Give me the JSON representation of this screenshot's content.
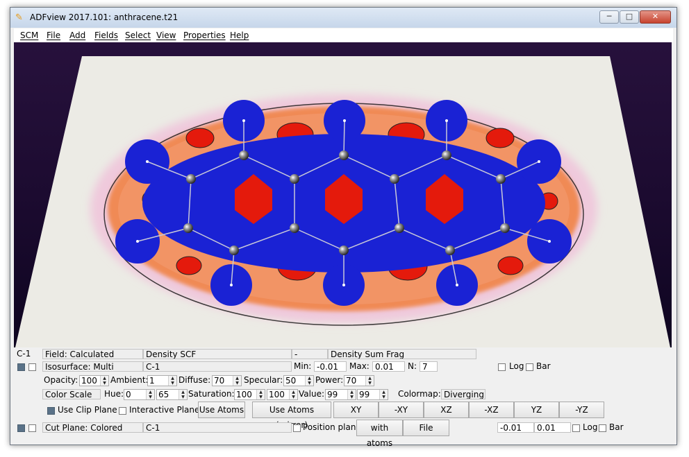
{
  "window": {
    "title": "ADFview 2017.101: anthracene.t21",
    "minimize_glyph": "─",
    "maximize_glyph": "□",
    "close_glyph": "✕"
  },
  "menu": [
    "SCM",
    "File",
    "Add",
    "Fields",
    "Select",
    "View",
    "Properties",
    "Help"
  ],
  "field_row": {
    "id": "C-1",
    "field": "Field: Calculated",
    "name": "Density SCF",
    "op": "-",
    "name2": "Density Sum Frag"
  },
  "iso_row": {
    "iso": "Isosurface: Multi",
    "frag": "C-1",
    "min_label": "Min:",
    "min": "-0.01",
    "max_label": "Max:",
    "max": "0.01",
    "n_label": "N:",
    "n": "7",
    "log": "Log",
    "bar": "Bar"
  },
  "opacity_row": {
    "opacity_label": "Opacity:",
    "opacity": "100",
    "ambient_label": "Ambient:",
    "ambient": "1",
    "diffuse_label": "Diffuse:",
    "diffuse": "70",
    "specular_label": "Specular:",
    "specular": "50",
    "power_label": "Power:",
    "power": "70"
  },
  "color_row": {
    "scale": "Color Scale",
    "hue_label": "Hue:",
    "hue1": "0",
    "hue2": "65",
    "sat_label": "Saturation:",
    "sat1": "100",
    "sat2": "100",
    "val_label": "Value:",
    "val1": "99",
    "val2": "99",
    "cmap_label": "Colormap:",
    "cmap": "Diverging"
  },
  "clip_row": {
    "use_clip": "Use Clip Plane",
    "interactive": "Interactive Plane",
    "use_atoms": "Use Atoms",
    "use_atoms_mirror": "Use Atoms (mirror)",
    "views": [
      "XY",
      "-XY",
      "XZ",
      "-XZ",
      "YZ",
      "-YZ"
    ]
  },
  "cut_row": {
    "cut": "Cut Plane: Colored",
    "frag": "C-1",
    "position": "Position plane",
    "with_atoms": "with atoms",
    "file": "File",
    "min": "-0.01",
    "max": "0.01",
    "log": "Log",
    "bar": "Bar"
  },
  "colors": {
    "blue": "#1a22d4",
    "red": "#e41a0c",
    "orange": "#f08a54",
    "pink": "#efc9dc",
    "plane": "#ecebe5",
    "background": "#1f0d35"
  },
  "molecule": {
    "atoms": [
      "C",
      "H"
    ],
    "rings": 3
  }
}
